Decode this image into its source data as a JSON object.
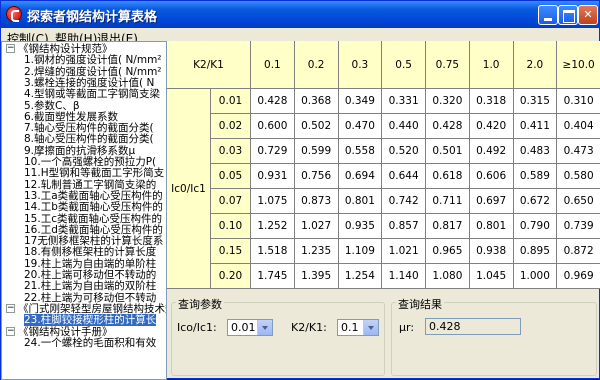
{
  "window": {
    "title": "探索者钢结构计算表格"
  },
  "menu": [
    "控制(C)",
    "帮助(H)",
    "退出(E)"
  ],
  "tree": [
    {
      "kind": "folder",
      "label": "《钢结构设计规范》",
      "expanded": true
    },
    {
      "kind": "item",
      "label": "1.钢材的强度设计值( N/mm²"
    },
    {
      "kind": "item",
      "label": "2.焊缝的强度设计值( N/mm²"
    },
    {
      "kind": "item",
      "label": "3.螺栓连接的强度设计值( N"
    },
    {
      "kind": "item",
      "label": "4.型钢或等截面工字钢简支梁"
    },
    {
      "kind": "item",
      "label": "5.参数C、β"
    },
    {
      "kind": "item",
      "label": "6.截面塑性发展系数"
    },
    {
      "kind": "item",
      "label": "7.轴心受压构件的截面分类("
    },
    {
      "kind": "item",
      "label": "8.轴心受压构件的截面分类("
    },
    {
      "kind": "item",
      "label": "9.摩擦面的抗滑移系数μ"
    },
    {
      "kind": "item",
      "label": "10.一个高强螺栓的预拉力P("
    },
    {
      "kind": "item",
      "label": "11.H型钢和等截面工字形简支"
    },
    {
      "kind": "item",
      "label": "12.轧制普通工字钢简支梁的"
    },
    {
      "kind": "item",
      "label": "13.工a类截面轴心受压构件的"
    },
    {
      "kind": "item",
      "label": "14.工b类截面轴心受压构件的"
    },
    {
      "kind": "item",
      "label": "15.工c类截面轴心受压构件的"
    },
    {
      "kind": "item",
      "label": "16.工d类截面轴心受压构件的"
    },
    {
      "kind": "item",
      "label": "17无侧移框架柱的计算长度系"
    },
    {
      "kind": "item",
      "label": "18.有侧移框架柱的计算长度"
    },
    {
      "kind": "item",
      "label": "19.柱上端为自由端的单阶柱"
    },
    {
      "kind": "item",
      "label": "20.柱上端可移动但不转动的"
    },
    {
      "kind": "item",
      "label": "21.柱上端为自由端的双阶柱"
    },
    {
      "kind": "item",
      "label": "22.柱上端为可移动但不转动"
    },
    {
      "kind": "folder",
      "label": "《门式刚架轻型房屋钢结构技术规",
      "expanded": true
    },
    {
      "kind": "item",
      "label": "23.柱脚铰接楔形柱的计算长",
      "selected": true
    },
    {
      "kind": "folder",
      "label": "《钢结构设计手册》",
      "expanded": true
    },
    {
      "kind": "item",
      "label": "24.一个螺栓的毛面积和有效"
    }
  ],
  "table": {
    "corner_label": "K2/K1",
    "row_header_label": "Ic0/Ic1",
    "columns": [
      "0.1",
      "0.2",
      "0.3",
      "0.5",
      "0.75",
      "1.0",
      "2.0",
      "≥10.0"
    ],
    "rows": [
      {
        "label": "0.01",
        "values": [
          "0.428",
          "0.368",
          "0.349",
          "0.331",
          "0.320",
          "0.318",
          "0.315",
          "0.310"
        ]
      },
      {
        "label": "0.02",
        "values": [
          "0.600",
          "0.502",
          "0.470",
          "0.440",
          "0.428",
          "0.420",
          "0.411",
          "0.404"
        ]
      },
      {
        "label": "0.03",
        "values": [
          "0.729",
          "0.599",
          "0.558",
          "0.520",
          "0.501",
          "0.492",
          "0.483",
          "0.473"
        ]
      },
      {
        "label": "0.05",
        "values": [
          "0.931",
          "0.756",
          "0.694",
          "0.644",
          "0.618",
          "0.606",
          "0.589",
          "0.580"
        ]
      },
      {
        "label": "0.07",
        "values": [
          "1.075",
          "0.873",
          "0.801",
          "0.742",
          "0.711",
          "0.697",
          "0.672",
          "0.650"
        ]
      },
      {
        "label": "0.10",
        "values": [
          "1.252",
          "1.027",
          "0.935",
          "0.857",
          "0.817",
          "0.801",
          "0.790",
          "0.739"
        ]
      },
      {
        "label": "0.15",
        "values": [
          "1.518",
          "1.235",
          "1.109",
          "1.021",
          "0.965",
          "0.938",
          "0.895",
          "0.872"
        ]
      },
      {
        "label": "0.20",
        "values": [
          "1.745",
          "1.395",
          "1.254",
          "1.140",
          "1.080",
          "1.045",
          "1.000",
          "0.969"
        ]
      }
    ]
  },
  "query": {
    "group_label": "查询参数",
    "ic_label": "Ico/Ic1:",
    "ic_value": "0.01",
    "k_label": "K2/K1:",
    "k_value": "0.1"
  },
  "result": {
    "group_label": "查询结果",
    "mu_label": "μr:",
    "mu_value": "0.428"
  }
}
